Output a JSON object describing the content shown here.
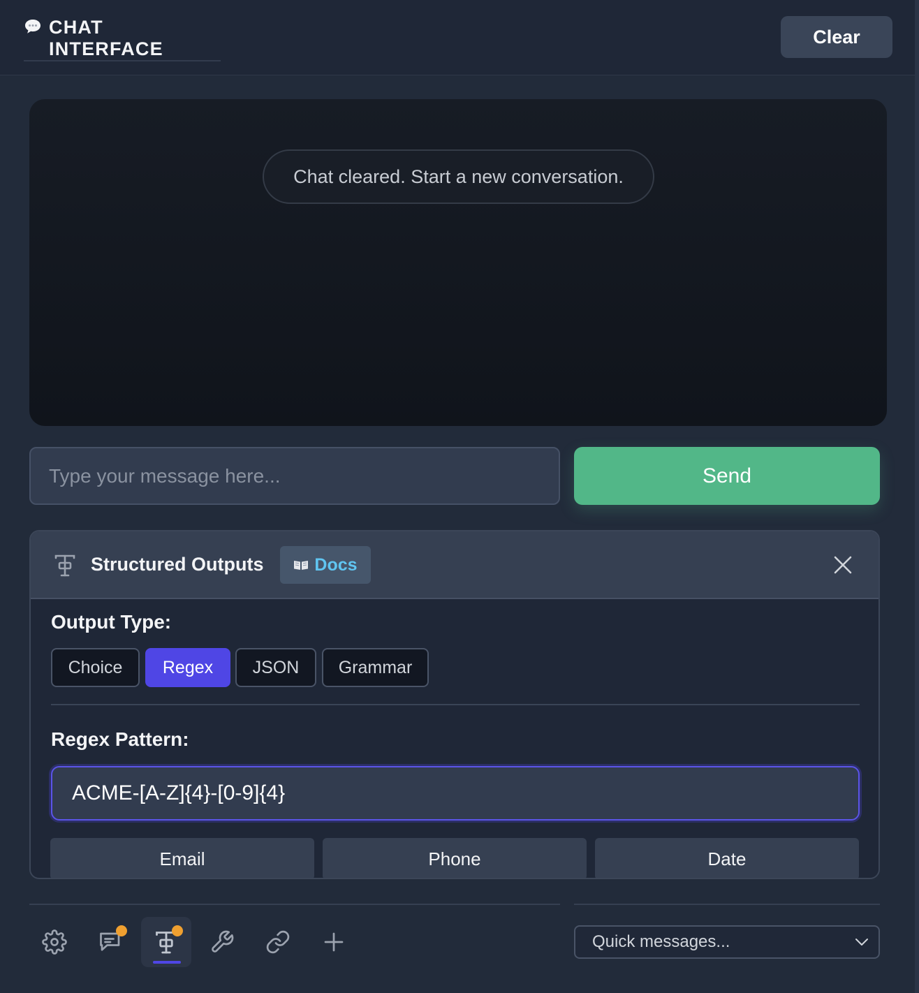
{
  "header": {
    "title": "CHAT INTERFACE",
    "title_icon": "speech-bubble-icon",
    "clear_label": "Clear"
  },
  "chat": {
    "system_message": "Chat cleared. Start a new conversation."
  },
  "composer": {
    "placeholder": "Type your message here...",
    "value": "",
    "send_label": "Send"
  },
  "structured_outputs": {
    "title": "Structured Outputs",
    "title_icon": "structured-output-icon",
    "docs_label": "Docs",
    "docs_icon": "open-book-icon",
    "output_type_label": "Output Type:",
    "output_types": [
      {
        "label": "Choice",
        "active": false
      },
      {
        "label": "Regex",
        "active": true
      },
      {
        "label": "JSON",
        "active": false
      },
      {
        "label": "Grammar",
        "active": false
      }
    ],
    "pattern_label": "Regex Pattern:",
    "pattern_value": "ACME-[A-Z]{4}-[0-9]{4}",
    "presets": [
      "Email",
      "Phone",
      "Date"
    ]
  },
  "toolbar": {
    "tools": [
      {
        "icon": "gear-icon",
        "badge": false,
        "active": false
      },
      {
        "icon": "chat-bubble-icon",
        "badge": true,
        "active": false
      },
      {
        "icon": "structured-output-icon",
        "badge": true,
        "active": true
      },
      {
        "icon": "wrench-icon",
        "badge": false,
        "active": false
      },
      {
        "icon": "link-icon",
        "badge": false,
        "active": false
      },
      {
        "icon": "plus-icon",
        "badge": false,
        "active": false
      }
    ],
    "quick_messages_placeholder": "Quick messages..."
  },
  "colors": {
    "background": "#222b3a",
    "accent": "#4f46e5",
    "send": "#52b788",
    "docs_text": "#60c5f1",
    "badge": "#f0a030"
  }
}
